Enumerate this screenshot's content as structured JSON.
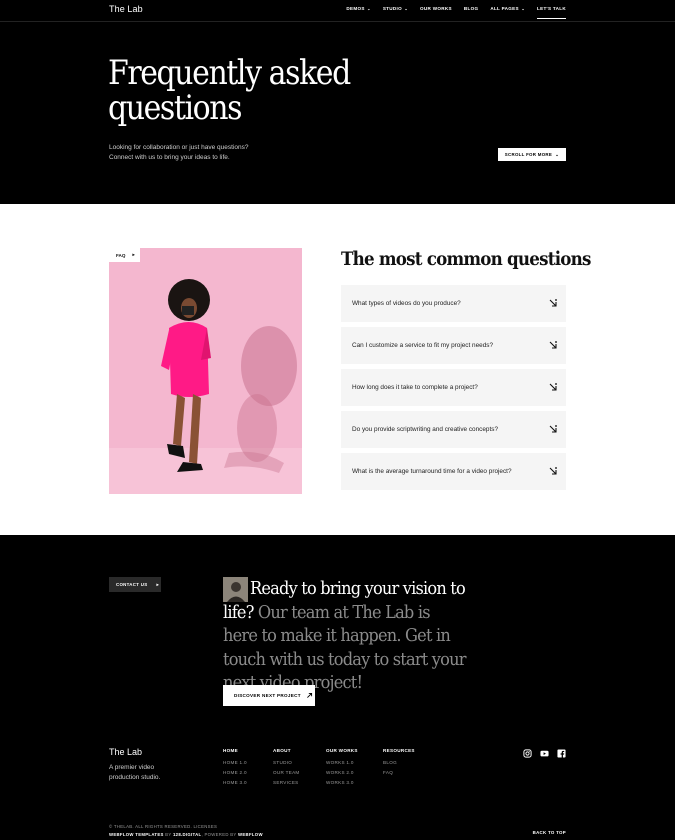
{
  "nav": {
    "logo": "The Lab",
    "links": [
      {
        "label": "DEMOS",
        "dropdown": true
      },
      {
        "label": "STUDIO",
        "dropdown": true
      },
      {
        "label": "OUR WORKS",
        "dropdown": false
      },
      {
        "label": "BLOG",
        "dropdown": false
      },
      {
        "label": "ALL PAGES",
        "dropdown": true
      }
    ],
    "cta": "LET'S TALK"
  },
  "hero": {
    "title_line1": "Frequently asked",
    "title_line2": "questions",
    "subtitle_line1": "Looking for collaboration or just have questions?",
    "subtitle_line2": "Connect with us to bring your ideas to life.",
    "scroll_button": "SCROLL FOR MORE",
    "scroll_icon": "chevron-down-icon"
  },
  "faq": {
    "tag": "FAQ",
    "heading": "The most common questions",
    "items": [
      {
        "question": "What types of videos do you produce?"
      },
      {
        "question": "Can I customize a service to fit my project needs?"
      },
      {
        "question": "How long does it take to complete a project?"
      },
      {
        "question": "Do you provide scriptwriting and creative concepts?"
      },
      {
        "question": "What is the average turnaround time for a video project?"
      }
    ],
    "item_icon": "expand-arrow-icon",
    "image_bg": "#f4b7cf",
    "accent_pink": "#ff1a86"
  },
  "cta": {
    "contact_button": "CONTACT US",
    "headline_white": "Ready to bring your vision to life?",
    "headline_grey": "Our team at The Lab is here to make it happen. Get in touch with us today to start your next video project!",
    "discover_button": "DISCOVER NEXT PROJECT"
  },
  "footer": {
    "logo": "The Lab",
    "tagline": "A premier video production studio.",
    "columns": [
      {
        "title": "HOME",
        "links": [
          "HOME 1.0",
          "HOME 2.0",
          "HOME 3.0"
        ]
      },
      {
        "title": "ABOUT",
        "links": [
          "STUDIO",
          "OUR TEAM",
          "SERVICES"
        ]
      },
      {
        "title": "OUR WORKS",
        "links": [
          "WORKS 1.0",
          "WORKS 2.0",
          "WORKS 3.0"
        ]
      },
      {
        "title": "RESOURCES",
        "links": [
          "BLOG",
          "FAQ"
        ]
      }
    ],
    "social": [
      "instagram-icon",
      "youtube-icon",
      "facebook-icon"
    ],
    "copyright": "© THELAB. ALL RIGHTS RESERVED. LICENSES",
    "credits_prefix": "WEBFLOW TEMPLATES",
    "credits_by": "BY",
    "credits_studio": "128.DIGITAL",
    "credits_powered": "POWERED BY",
    "credits_webflow": "WEBFLOW",
    "back_to_top": "BACK TO TOP"
  },
  "colors": {
    "background_dark": "#000000",
    "background_light": "#ffffff",
    "faq_item_bg": "#f5f5f5",
    "muted_text": "#8b8b8b"
  }
}
